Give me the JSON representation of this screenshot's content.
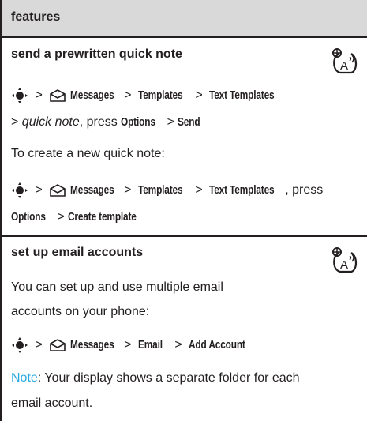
{
  "header": {
    "title": "features"
  },
  "sections": [
    {
      "title": "send a prewritten quick note",
      "path1": {
        "sep": ">",
        "messages": "Messages",
        "templates": "Templates",
        "text_templates": "Text Templates"
      },
      "path1b": {
        "quick_note": "quick note",
        "press": ", press",
        "options": "Options",
        "send": "Send"
      },
      "intro": "To create a new quick note:",
      "path2": {
        "messages": "Messages",
        "templates": "Templates",
        "text_templates": "Text Templates",
        "press": ", press"
      },
      "path2b": {
        "options": "Options",
        "create_template": "Create template"
      }
    },
    {
      "title": "set up email accounts",
      "body_line1": "You can set up and use multiple email",
      "body_line2": "accounts on your phone:",
      "path": {
        "messages": "Messages",
        "email": "Email",
        "add_account": "Add Account"
      },
      "note_label": "Note",
      "note_text": ": Your display shows a separate folder for each",
      "note_text2": "email account."
    }
  ],
  "colors": {
    "note_accent": "#29abe2",
    "header_bg": "#d9d9d9",
    "text": "#231f20"
  },
  "icons": [
    "nav-key-icon",
    "messages-envelope-icon",
    "network-feature-icon"
  ]
}
